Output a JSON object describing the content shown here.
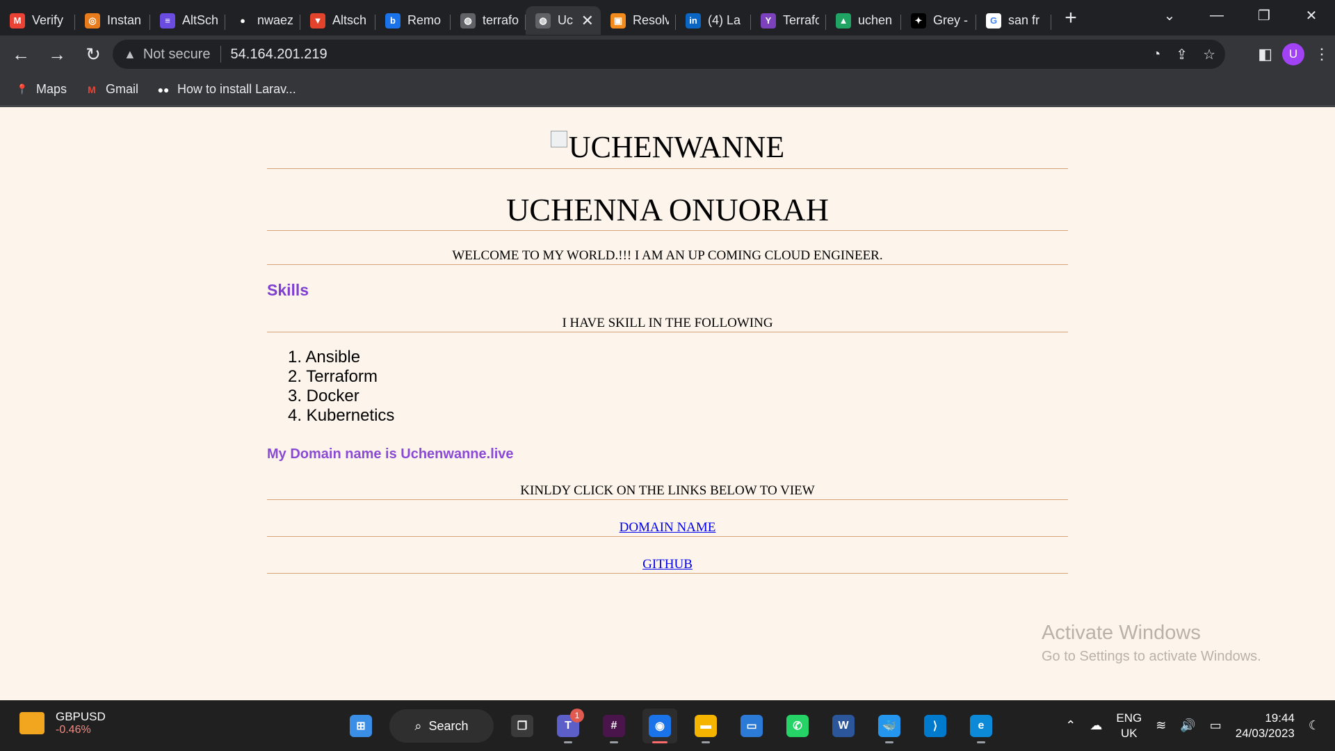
{
  "browser": {
    "tabs": [
      {
        "title": "Verify",
        "icon": "gmail-icon",
        "color": "#ea4335",
        "glyph": "M"
      },
      {
        "title": "Instan",
        "icon": "aws-icon",
        "color": "#e87b1c",
        "glyph": "◎"
      },
      {
        "title": "AltSch",
        "icon": "altschool-icon",
        "color": "#6a4ce0",
        "glyph": "≡"
      },
      {
        "title": "nwaez",
        "icon": "github-icon",
        "color": "#202124",
        "glyph": "●"
      },
      {
        "title": "Altsch",
        "icon": "gitlab-icon",
        "color": "#e2432a",
        "glyph": "▼"
      },
      {
        "title": "Remo",
        "icon": "remote-icon",
        "color": "#1a73e8",
        "glyph": "b"
      },
      {
        "title": "terrafo",
        "icon": "globe-icon",
        "color": "#5f6368",
        "glyph": "◍"
      },
      {
        "title": "Uc",
        "icon": "globe-icon",
        "color": "#5f6368",
        "glyph": "◍",
        "active": true
      },
      {
        "title": "Resolv",
        "icon": "box-icon",
        "color": "#f28a1c",
        "glyph": "▣"
      },
      {
        "title": "(4) La",
        "icon": "linkedin-icon",
        "color": "#0a66c2",
        "glyph": "in"
      },
      {
        "title": "Terrafo",
        "icon": "terraform-icon",
        "color": "#7b42bc",
        "glyph": "Y"
      },
      {
        "title": "uchen",
        "icon": "google-drive-icon",
        "color": "#1fa463",
        "glyph": "▲"
      },
      {
        "title": "Grey -",
        "icon": "grey-icon",
        "color": "#000000",
        "glyph": "✦"
      },
      {
        "title": "san fr",
        "icon": "google-icon",
        "color": "#ffffff",
        "glyph": "G"
      }
    ],
    "new_tab": "+",
    "window": {
      "minimize": "—",
      "restore": "❐",
      "close": "✕",
      "dropdown": "⌄"
    },
    "nav": {
      "back": "←",
      "forward": "→",
      "reload": "↻"
    },
    "address": {
      "warning": "▲",
      "not_secure": "Not secure",
      "url": "54.164.201.219"
    },
    "omni_icons": {
      "performance": "◔",
      "share": "⇪",
      "star": "☆"
    },
    "side_panel": "◧",
    "avatar": "U",
    "menu": "⋮",
    "bookmarks": [
      {
        "label": "Maps",
        "icon": "maps-icon",
        "glyph": "📍",
        "color": "#34a853"
      },
      {
        "label": "Gmail",
        "icon": "gmail-icon",
        "glyph": "M",
        "color": "#ea4335"
      },
      {
        "label": "How to install Larav...",
        "icon": "medium-icon",
        "glyph": "●●",
        "color": "#ffffff"
      }
    ]
  },
  "page": {
    "logo_alt": "UCHENWANNE",
    "name": "UCHENNA ONUORAH",
    "welcome": "WELCOME TO MY WORLD.!!! I AM AN UP COMING CLOUD ENGINEER.",
    "skills_heading": "Skills",
    "skills_intro": "I HAVE SKILL IN THE FOLLOWING",
    "skills": [
      "1. Ansible",
      "2. Terraform",
      "3. Docker",
      "4. Kubernetics"
    ],
    "domain_text": "My Domain name is Uchenwanne.live",
    "links_intro": "KINLDY CLICK ON THE LINKS BELOW TO VIEW",
    "link_domain": "DOMAIN NAME",
    "link_github": "GITHUB"
  },
  "watermark": {
    "title": "Activate Windows",
    "subtitle": "Go to Settings to activate Windows."
  },
  "taskbar": {
    "ticker_symbol": "GBPUSD",
    "ticker_change": "-0.46%",
    "search_label": "Search",
    "teams_badge": "1",
    "apps": [
      {
        "name": "windows-start-icon",
        "color": "#3b8ee6",
        "glyph": "⊞"
      },
      {
        "name": "task-view-icon",
        "color": "#3a3a3a",
        "glyph": "❐"
      },
      {
        "name": "teams-icon",
        "color": "#5b5fc7",
        "glyph": "T"
      },
      {
        "name": "slack-icon",
        "color": "#4a154b",
        "glyph": "#"
      },
      {
        "name": "chrome-icon",
        "color": "#1a73e8",
        "glyph": "◉"
      },
      {
        "name": "file-explorer-icon",
        "color": "#f4b400",
        "glyph": "▬"
      },
      {
        "name": "remote-desktop-icon",
        "color": "#2a7ad6",
        "glyph": "▭"
      },
      {
        "name": "whatsapp-icon",
        "color": "#25d366",
        "glyph": "✆"
      },
      {
        "name": "word-icon",
        "color": "#2b579a",
        "glyph": "W"
      },
      {
        "name": "docker-icon",
        "color": "#2496ed",
        "glyph": "🐳"
      },
      {
        "name": "vscode-icon",
        "color": "#007acc",
        "glyph": "⟩"
      },
      {
        "name": "edge-icon",
        "color": "#0c8ad8",
        "glyph": "e"
      }
    ],
    "tray": {
      "chevron": "⌃",
      "cloud": "☁",
      "lang1": "ENG",
      "lang2": "UK",
      "wifi": "≋",
      "volume": "🔊",
      "battery": "▭",
      "time": "19:44",
      "date": "24/03/2023",
      "night": "☾"
    }
  }
}
